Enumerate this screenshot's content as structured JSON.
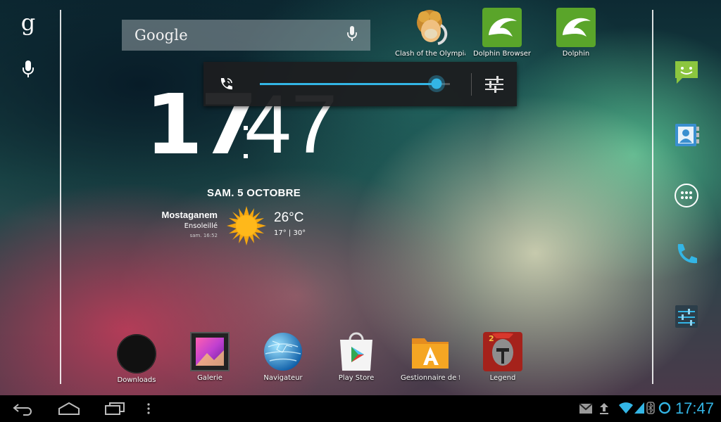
{
  "search": {
    "logo": "Google"
  },
  "top_apps": [
    {
      "label": "Clash of the Olympians"
    },
    {
      "label": "Dolphin Browser"
    },
    {
      "label": "Dolphin"
    }
  ],
  "volume": {
    "level": 0.93
  },
  "clock": {
    "hours": "17",
    "minutes": "47"
  },
  "weather": {
    "date": "SAM. 5 OCTOBRE",
    "city": "Mostaganem",
    "condition": "Ensoleillé",
    "updated": "sam. 16:52",
    "temperature": "26°C",
    "range": "17° | 30°"
  },
  "bottom_apps": [
    {
      "label": "Downloads"
    },
    {
      "label": "Galerie"
    },
    {
      "label": "Navigateur"
    },
    {
      "label": "Play Store"
    },
    {
      "label": "Gestionnaire de fichiers"
    },
    {
      "label": "Legend"
    }
  ],
  "status": {
    "time": "17:47"
  },
  "colors": {
    "accent": "#33b5e5",
    "messaging": "#8cc63f",
    "phone": "#33b5e5"
  }
}
